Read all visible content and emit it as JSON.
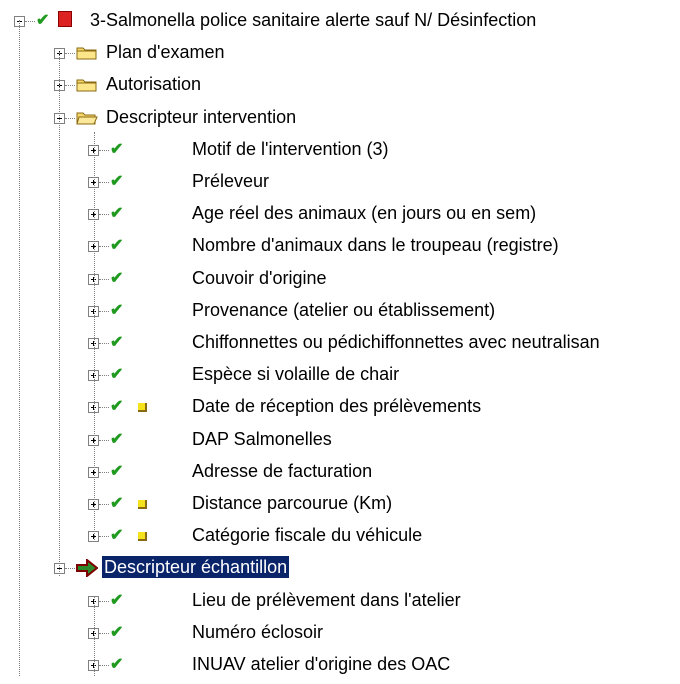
{
  "root": {
    "label": "3-Salmonella police sanitaire alerte sauf N/ Désinfection",
    "icon": "red-document-icon"
  },
  "groups": [
    {
      "label": "Plan d'examen",
      "icon": "folder-icon",
      "expanded": false
    },
    {
      "label": "Autorisation",
      "icon": "folder-icon",
      "expanded": false
    },
    {
      "label": "Descripteur intervention",
      "icon": "folder-open-icon",
      "expanded": true
    }
  ],
  "intervention_items": [
    {
      "label": "Motif de l'intervention (3)",
      "flag": false
    },
    {
      "label": "Préleveur",
      "flag": false
    },
    {
      "label": "Age réel des animaux (en jours ou en sem)",
      "flag": false
    },
    {
      "label": "Nombre d'animaux dans le troupeau (registre)",
      "flag": false
    },
    {
      "label": "Couvoir d'origine",
      "flag": false
    },
    {
      "label": "Provenance (atelier ou établissement)",
      "flag": false
    },
    {
      "label": "Chiffonnettes ou pédichiffonnettes avec neutralisan",
      "flag": false
    },
    {
      "label": "Espèce si volaille de chair",
      "flag": false
    },
    {
      "label": "Date de réception des prélèvements",
      "flag": true
    },
    {
      "label": "DAP Salmonelles",
      "flag": false
    },
    {
      "label": "Adresse de facturation",
      "flag": false
    },
    {
      "label": "Distance parcourue (Km)",
      "flag": true
    },
    {
      "label": "Catégorie fiscale du véhicule",
      "flag": true
    }
  ],
  "sample_group": {
    "label": "Descripteur échantillon",
    "icon": "green-red-arrow-icon",
    "selected": true
  },
  "sample_items": [
    {
      "label": "Lieu de prélèvement dans l'atelier",
      "flag": false
    },
    {
      "label": "Numéro  éclosoir",
      "flag": false
    },
    {
      "label": "INUAV atelier d'origine des OAC",
      "flag": false
    }
  ],
  "colors": {
    "check": "#1f9a1f",
    "selection": "#0a246a",
    "flag": "#f4e21a",
    "folder": "#f5d76e"
  }
}
